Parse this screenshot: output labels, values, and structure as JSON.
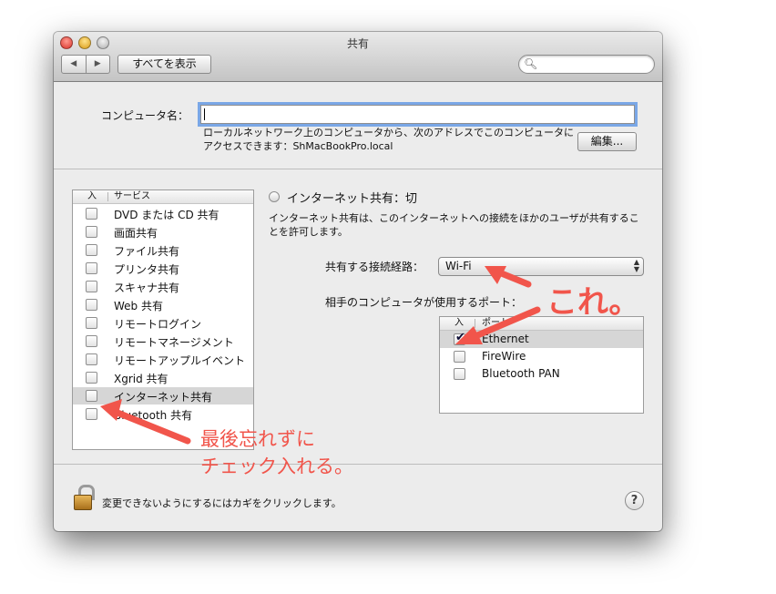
{
  "window": {
    "title": "共有",
    "nav_back": "◀",
    "nav_forward": "▶",
    "show_all": "すべてを表示",
    "search_placeholder": ""
  },
  "computer_name": {
    "label": "コンピュータ名：",
    "value": "",
    "description_line1": "ローカルネットワーク上のコンピュータから、次のアドレスでこのコンピュータに",
    "description_line2": "アクセスできます：ShMacBookPro.local",
    "edit_button": "編集..."
  },
  "services": {
    "header_on": "入",
    "header_service": "サービス",
    "items": [
      {
        "label": "DVD または CD 共有",
        "checked": false,
        "selected": false
      },
      {
        "label": "画面共有",
        "checked": false,
        "selected": false
      },
      {
        "label": "ファイル共有",
        "checked": false,
        "selected": false
      },
      {
        "label": "プリンタ共有",
        "checked": false,
        "selected": false
      },
      {
        "label": "スキャナ共有",
        "checked": false,
        "selected": false
      },
      {
        "label": "Web 共有",
        "checked": false,
        "selected": false
      },
      {
        "label": "リモートログイン",
        "checked": false,
        "selected": false
      },
      {
        "label": "リモートマネージメント",
        "checked": false,
        "selected": false
      },
      {
        "label": "リモートアップルイベント",
        "checked": false,
        "selected": false
      },
      {
        "label": "Xgrid 共有",
        "checked": false,
        "selected": false
      },
      {
        "label": "インターネット共有",
        "checked": false,
        "selected": true
      },
      {
        "label": "Bluetooth 共有",
        "checked": false,
        "selected": false
      }
    ]
  },
  "internet_sharing": {
    "status": "インターネット共有：切",
    "description_line1": "インターネット共有は、このインターネットへの接続をほかのユーザが共有するこ",
    "description_line2": "とを許可します。",
    "share_from_label": "共有する接続経路：",
    "share_from_value": "Wi-Fi",
    "ports_label": "相手のコンピュータが使用するポート：",
    "ports_header_on": "入",
    "ports_header_port": "ポート",
    "ports": [
      {
        "label": "Ethernet",
        "checked": true,
        "selected": true
      },
      {
        "label": "FireWire",
        "checked": false,
        "selected": false
      },
      {
        "label": "Bluetooth PAN",
        "checked": false,
        "selected": false
      }
    ]
  },
  "footer": {
    "lock_text": "変更できないようにするにはカギをクリックします。",
    "help": "?"
  },
  "annotations": {
    "kore": "これ。",
    "note_line1": "最後忘れずに",
    "note_line2": "チェック入れる。",
    "color": "#f1554b"
  }
}
